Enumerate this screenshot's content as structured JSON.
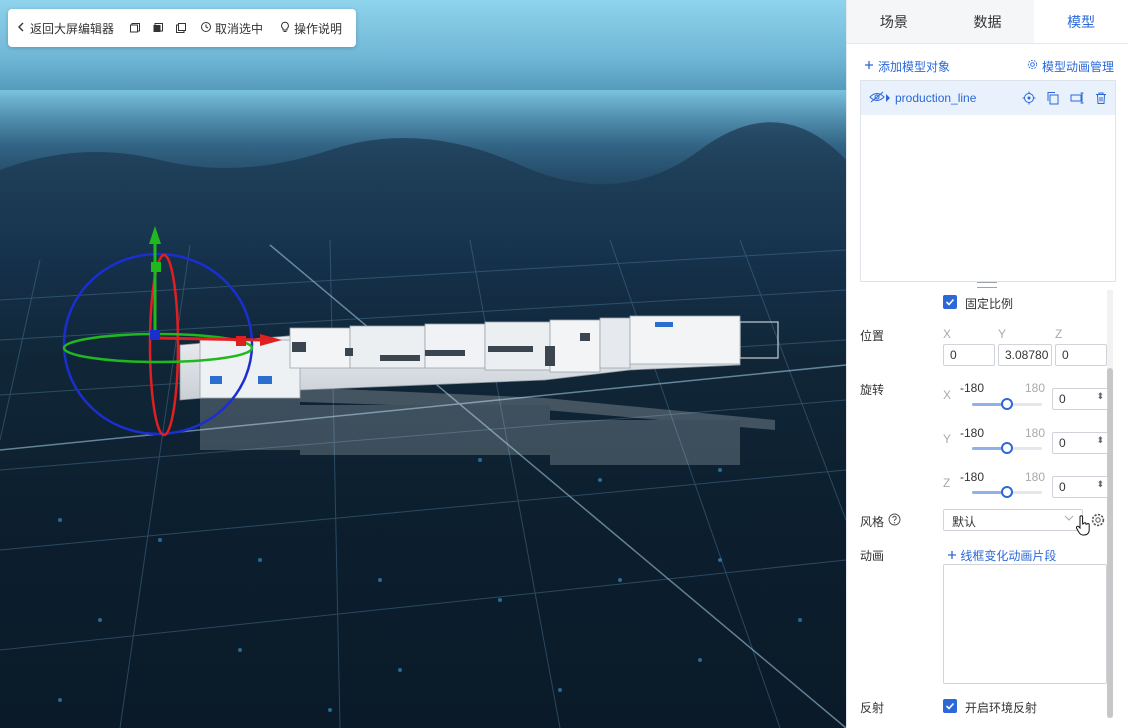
{
  "toolbar": {
    "back_label": "返回大屏编辑器",
    "deselect_label": "取消选中",
    "help_label": "操作说明"
  },
  "tabs": [
    {
      "label": "场景",
      "active": false
    },
    {
      "label": "数据",
      "active": false
    },
    {
      "label": "模型",
      "active": true
    }
  ],
  "model_panel": {
    "add_object_label": "添加模型对象",
    "animation_manage_label": "模型动画管理",
    "tree": [
      {
        "name": "production_line"
      }
    ]
  },
  "properties": {
    "lock_ratio_label": "固定比例",
    "lock_ratio_checked": true,
    "position": {
      "label": "位置",
      "x_label": "X",
      "y_label": "Y",
      "z_label": "Z",
      "x_value": "0",
      "y_value": "3.08780",
      "z_value": "0"
    },
    "rotation": {
      "label": "旋转",
      "rows": [
        {
          "axis": "X",
          "min": "-180",
          "max": "180",
          "value": "0",
          "fraction": 0.5
        },
        {
          "axis": "Y",
          "min": "-180",
          "max": "180",
          "value": "0",
          "fraction": 0.5
        },
        {
          "axis": "Z",
          "min": "-180",
          "max": "180",
          "value": "0",
          "fraction": 0.5
        }
      ]
    },
    "style": {
      "label": "风格",
      "selected": "默认"
    },
    "animation": {
      "label": "动画",
      "add_clip_label": "线框变化动画片段"
    },
    "reflection": {
      "label": "反射",
      "enable_label": "开启环境反射",
      "checked": true
    }
  },
  "colors": {
    "accent": "#2c68d8",
    "gizmo_x": "#e02020",
    "gizmo_y": "#1fb81f",
    "gizmo_z": "#1b2fd0"
  }
}
